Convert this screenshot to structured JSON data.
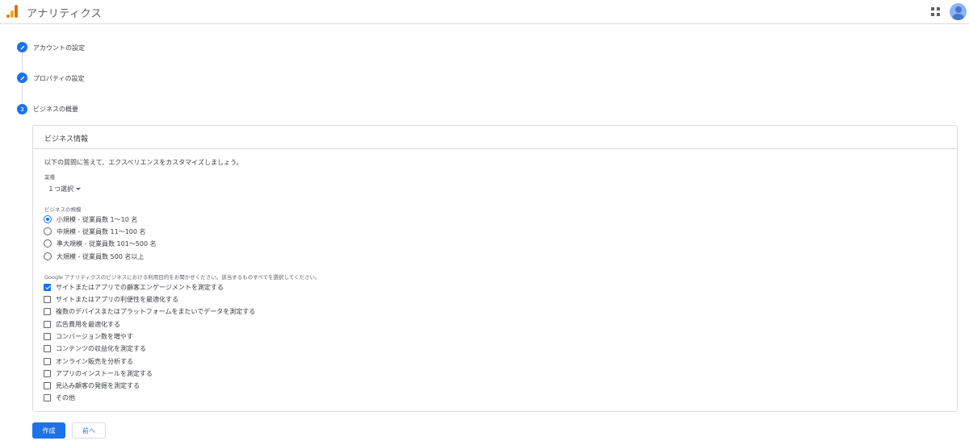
{
  "header": {
    "app_title": "アナリティクス",
    "logo_icon": "analytics-logo-icon",
    "apps_icon": "apps-grid-icon",
    "avatar_icon": "account-avatar-icon"
  },
  "stepper": {
    "steps": [
      {
        "label": "アカウントの設定",
        "state": "done",
        "icon": "pencil-icon"
      },
      {
        "label": "プロパティの設定",
        "state": "done",
        "icon": "pencil-icon"
      },
      {
        "label": "ビジネスの概要",
        "state": "current",
        "number": "3"
      }
    ]
  },
  "card": {
    "title": "ビジネス情報",
    "intro": "以下の質問に答えて、エクスペリエンスをカスタマイズしましょう。",
    "industry": {
      "label": "業種",
      "selected": "１つ選択"
    },
    "size": {
      "label": "ビジネスの規模",
      "options": [
        {
          "label": "小規模 - 従業員数 1〜10 名",
          "selected": true
        },
        {
          "label": "中規模 - 従業員数 11〜100 名",
          "selected": false
        },
        {
          "label": "準大規模 - 従業員数 101〜500 名",
          "selected": false
        },
        {
          "label": "大規模 - 従業員数 500 名以上",
          "selected": false
        }
      ]
    },
    "usage": {
      "label": "Google アナリティクスのビジネスにおける利用目的をお聞かせください。該当するものすべてを選択してください。",
      "options": [
        {
          "label": "サイトまたはアプリでの顧客エンゲージメントを測定する",
          "checked": true
        },
        {
          "label": "サイトまたはアプリの利便性を最適化する",
          "checked": false
        },
        {
          "label": "複数のデバイスまたはプラットフォームをまたいでデータを測定する",
          "checked": false
        },
        {
          "label": "広告費用を最適化する",
          "checked": false
        },
        {
          "label": "コンバージョン数を増やす",
          "checked": false
        },
        {
          "label": "コンテンツの収益化を測定する",
          "checked": false
        },
        {
          "label": "オンライン販売を分析する",
          "checked": false
        },
        {
          "label": "アプリのインストールを測定する",
          "checked": false
        },
        {
          "label": "見込み顧客の発掘を測定する",
          "checked": false
        },
        {
          "label": "その他",
          "checked": false
        }
      ]
    }
  },
  "footer": {
    "create_label": "作成",
    "back_label": "前へ"
  },
  "colors": {
    "accent": "#1a73e8",
    "border": "#dadce0",
    "text": "#3c4043",
    "logo_orange": "#e37400",
    "logo_yellow": "#f9ab00"
  }
}
